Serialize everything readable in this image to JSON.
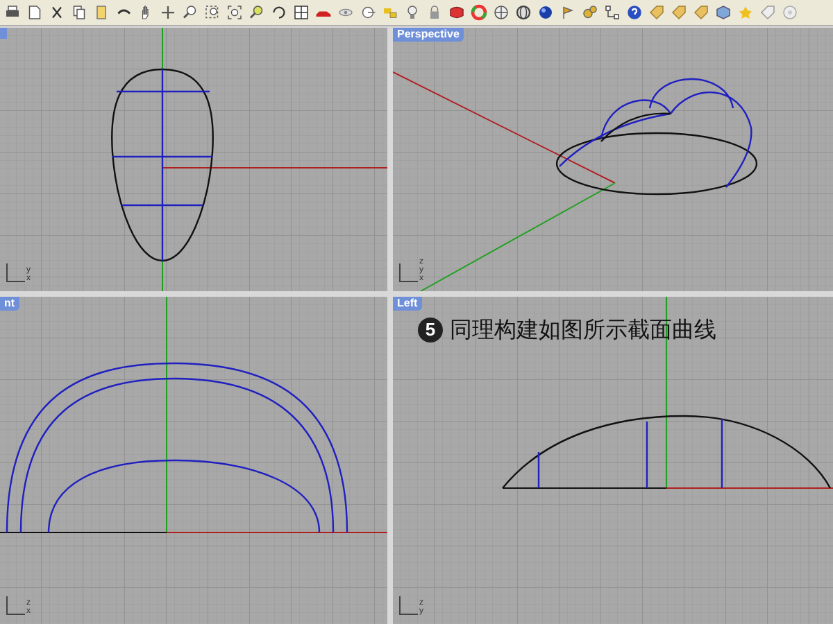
{
  "viewports": [
    {
      "kind": "top",
      "axes": [
        "y",
        "x"
      ]
    },
    {
      "kind": "perspective",
      "label": "Perspective",
      "axes": [
        "z",
        "y",
        "x"
      ]
    },
    {
      "kind": "front",
      "label": "nt",
      "axes": [
        "z",
        "x"
      ]
    },
    {
      "kind": "left",
      "label": "Left",
      "axes": [
        "z",
        "y"
      ],
      "annotation": {
        "step": "5",
        "text": "同理构建如图所示截面曲线"
      }
    }
  ]
}
